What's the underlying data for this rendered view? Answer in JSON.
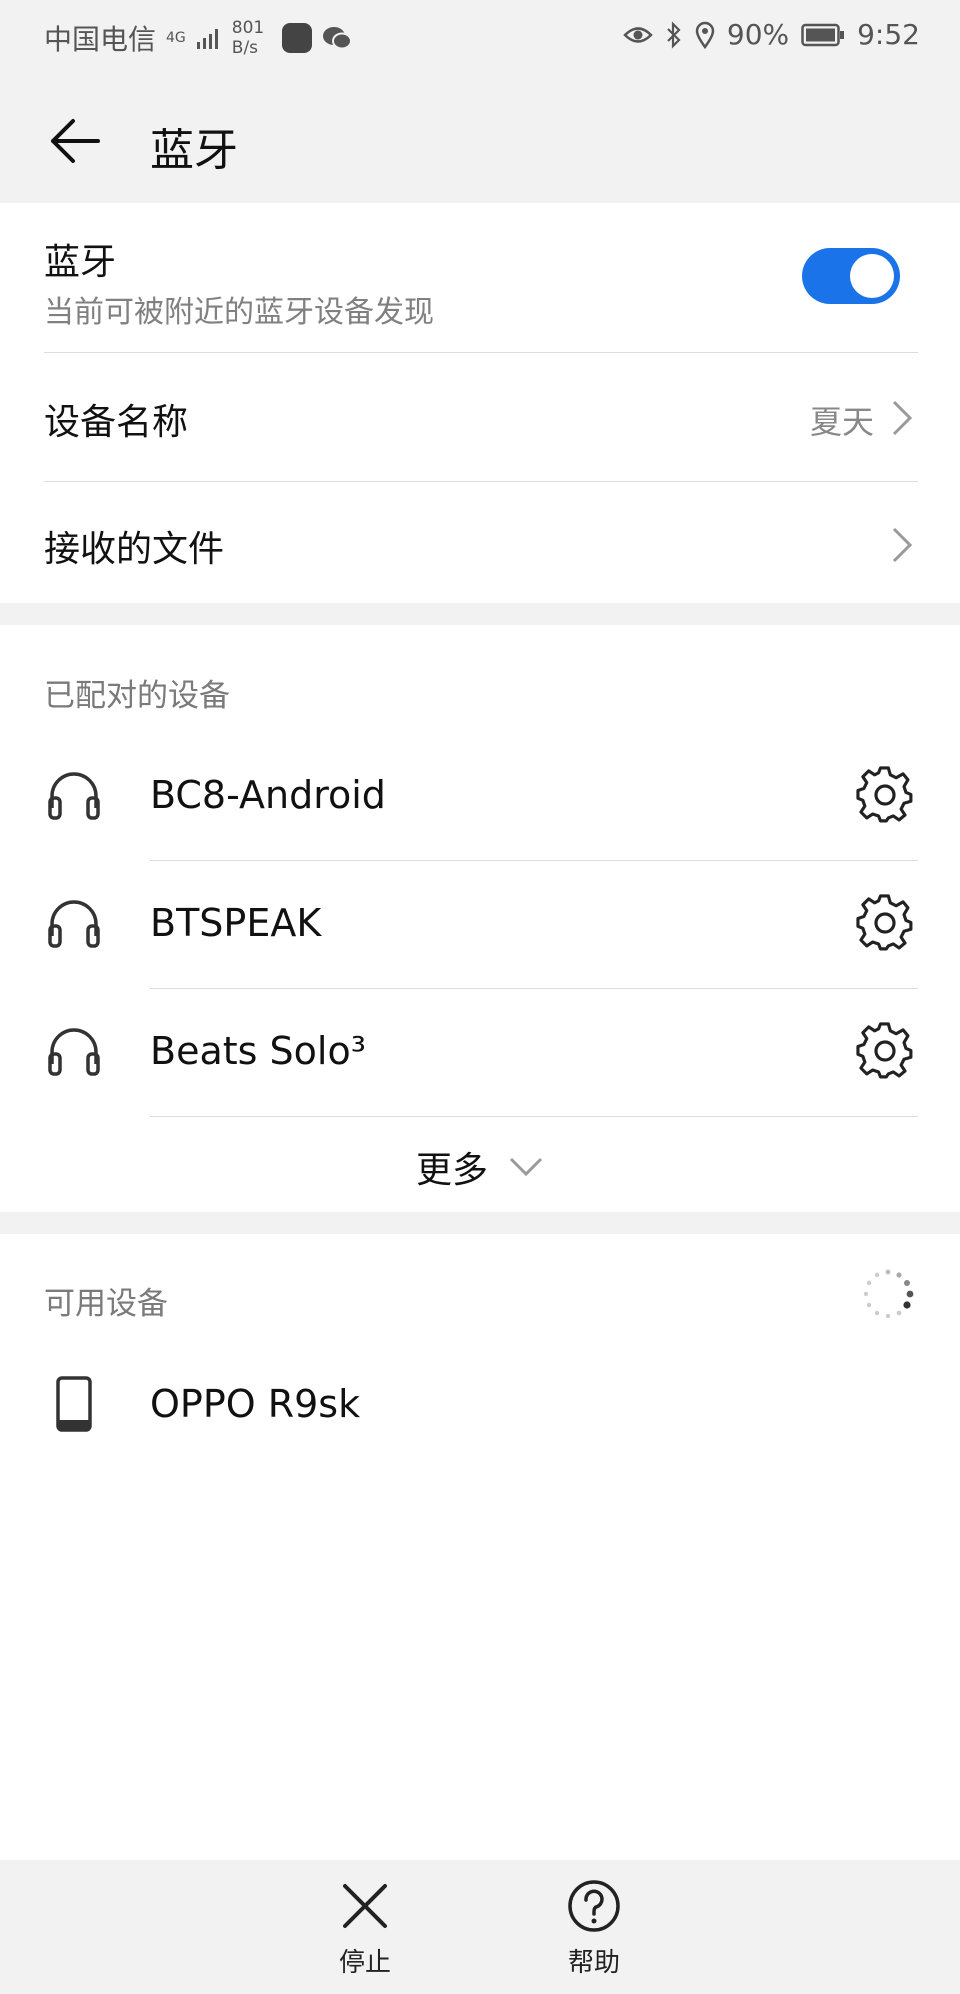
{
  "status_bar": {
    "carrier": "中国电信",
    "network": "4G",
    "speed_value": "801",
    "speed_unit": "B/s",
    "battery": "90%",
    "time": "9:52"
  },
  "app_bar": {
    "title": "蓝牙"
  },
  "bluetooth": {
    "label": "蓝牙",
    "subtitle": "当前可被附近的蓝牙设备发现",
    "enabled": true,
    "accent_color": "#1a73e8"
  },
  "device_name": {
    "label": "设备名称",
    "value": "夏天"
  },
  "received_files": {
    "label": "接收的文件"
  },
  "paired": {
    "header": "已配对的设备",
    "devices": [
      {
        "name": "BC8-Android",
        "icon": "headphones-icon"
      },
      {
        "name": "BTSPEAK",
        "icon": "headphones-icon"
      },
      {
        "name": "Beats Solo³",
        "icon": "headphones-icon"
      }
    ],
    "more_label": "更多"
  },
  "available": {
    "header": "可用设备",
    "devices": [
      {
        "name": "OPPO R9sk",
        "icon": "phone-icon"
      }
    ]
  },
  "bottom_bar": {
    "stop_label": "停止",
    "help_label": "帮助"
  }
}
